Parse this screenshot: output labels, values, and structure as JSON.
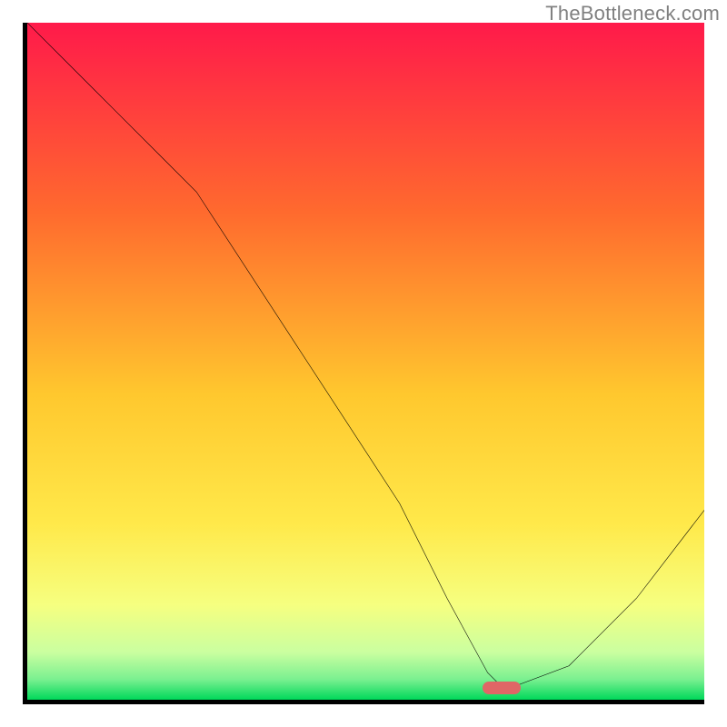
{
  "watermark": "TheBottleneck.com",
  "colors": {
    "top": "#ff1a4a",
    "mid_upper": "#ff8c2e",
    "mid": "#ffe033",
    "mid_lower": "#f8ff66",
    "near_bottom": "#c8ff80",
    "bottom": "#00e060",
    "curve": "#000000",
    "marker": "#e06666",
    "axis": "#000000",
    "watermark_text": "#808080"
  },
  "chart_data": {
    "type": "line",
    "title": "",
    "xlabel": "",
    "ylabel": "",
    "xlim": [
      0,
      100
    ],
    "ylim": [
      0,
      100
    ],
    "x": [
      0,
      5,
      10,
      20,
      25,
      40,
      55,
      62,
      68,
      70,
      72,
      80,
      90,
      100
    ],
    "values": [
      100,
      95,
      90,
      80,
      75,
      52,
      29,
      15,
      4,
      2,
      2,
      5,
      15,
      28
    ],
    "marker": {
      "x": 70,
      "y": 2,
      "width": 6,
      "height": 2
    },
    "notes": "Background is a red→yellow→green vertical gradient. Curve dips from top-left to a minimum near x≈70 then rises toward the right edge. No axis tick labels are shown."
  }
}
